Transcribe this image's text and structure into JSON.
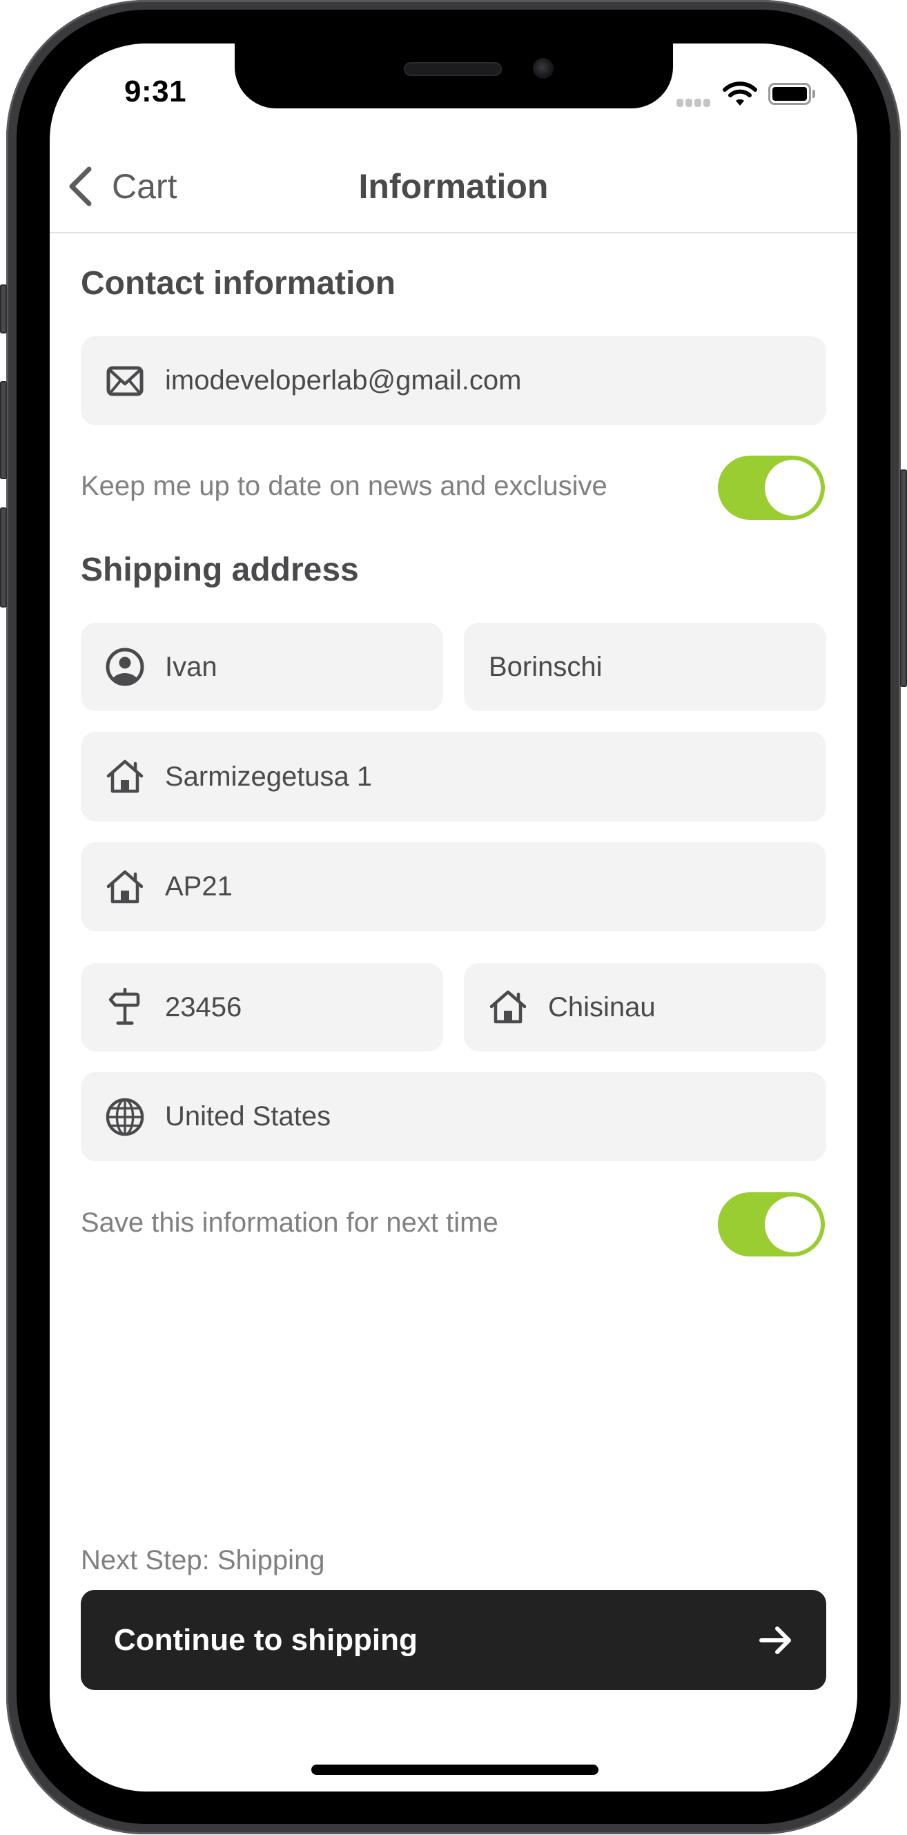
{
  "status_bar": {
    "time": "9:31",
    "signal_icon": "cellular-signal-icon",
    "wifi_icon": "wifi-icon",
    "battery_icon": "battery-full-icon"
  },
  "nav": {
    "back_label": "Cart",
    "back_icon": "chevron-left-icon",
    "title": "Information"
  },
  "contact": {
    "section_title": "Contact information",
    "email": {
      "icon": "envelope-icon",
      "value": "imodeveloperlab@gmail.com"
    },
    "newsletter": {
      "label": "Keep me up to date on news and exclusive",
      "enabled": true
    }
  },
  "shipping": {
    "section_title": "Shipping address",
    "first_name": {
      "icon": "person-circle-icon",
      "value": "Ivan"
    },
    "last_name": {
      "value": "Borinschi"
    },
    "address": {
      "icon": "house-icon",
      "value": "Sarmizegetusa 1"
    },
    "apartment": {
      "icon": "house-icon",
      "value": "AP21"
    },
    "postal_code": {
      "icon": "signpost-icon",
      "value": "23456"
    },
    "city": {
      "icon": "house-icon",
      "value": "Chisinau"
    },
    "country": {
      "icon": "globe-icon",
      "value": "United States"
    },
    "save_info": {
      "label": "Save this information for next time",
      "enabled": true
    }
  },
  "footer": {
    "next_step": "Next Step: Shipping",
    "cta_label": "Continue to shipping",
    "cta_icon": "arrow-right-icon"
  },
  "colors": {
    "toggle_on": "#9ACD32",
    "field_bg": "#F3F3F3",
    "cta_bg": "#222222",
    "text_primary": "#4A4A4C",
    "text_secondary": "#808082"
  }
}
